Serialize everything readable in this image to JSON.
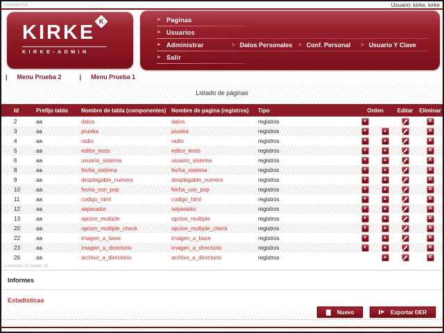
{
  "meta": {
    "version_label": "Versión C#",
    "user_label": "Usuario: kirke, kirke"
  },
  "logo": {
    "title": "KIRKE",
    "subtitle": "KIRKE-ADMIN",
    "badge_letter": "K"
  },
  "menu": {
    "items": [
      {
        "label": "Paginas"
      },
      {
        "label": "Usuarios"
      },
      {
        "label": "Administrar"
      },
      {
        "label": "Salir"
      }
    ],
    "submenu": [
      {
        "label": "Datos Personales"
      },
      {
        "label": "Conf. Personal"
      },
      {
        "label": "Usuario Y Clave"
      }
    ]
  },
  "secondary_menu": {
    "separator": "|",
    "items": [
      {
        "label": "Menu Prueba 2"
      },
      {
        "label": "Menu Prueba 1"
      }
    ]
  },
  "page": {
    "title": "Listado de páginas"
  },
  "table": {
    "columns": {
      "id": "Id",
      "prefijo": "Prefijo tabla",
      "tabla": "Nombre de tabla (componentes)",
      "pagina": "Nombre de pagina (registros)",
      "tipo": "Tipo",
      "orden": "Orden",
      "editar": "Editar",
      "eliminar": "Eliminar"
    },
    "rows": [
      {
        "id": "2",
        "prefijo": "aa",
        "tabla": "datos",
        "pagina": "datos",
        "tipo": "registros",
        "down": true,
        "up": false
      },
      {
        "id": "3",
        "prefijo": "aa",
        "tabla": "prueba",
        "pagina": "prueba",
        "tipo": "registros",
        "down": true,
        "up": true
      },
      {
        "id": "4",
        "prefijo": "aa",
        "tabla": "radio",
        "pagina": "radio",
        "tipo": "registros",
        "down": true,
        "up": true
      },
      {
        "id": "5",
        "prefijo": "aa",
        "tabla": "editor_texto",
        "pagina": "editor_texto",
        "tipo": "registros",
        "down": true,
        "up": true
      },
      {
        "id": "6",
        "prefijo": "aa",
        "tabla": "usuario_sistema",
        "pagina": "usuario_sistema",
        "tipo": "registros",
        "down": true,
        "up": true
      },
      {
        "id": "8",
        "prefijo": "aa",
        "tabla": "fecha_sistema",
        "pagina": "fecha_sistema",
        "tipo": "registros",
        "down": true,
        "up": true
      },
      {
        "id": "9",
        "prefijo": "aa",
        "tabla": "desplegable_numero",
        "pagina": "desplegable_numero",
        "tipo": "registros",
        "down": true,
        "up": true
      },
      {
        "id": "10",
        "prefijo": "aa",
        "tabla": "fecha_con_pop",
        "pagina": "fecha_con_pop",
        "tipo": "registros",
        "down": true,
        "up": true
      },
      {
        "id": "11",
        "prefijo": "aa",
        "tabla": "codigo_html",
        "pagina": "codigo_html",
        "tipo": "registros",
        "down": true,
        "up": true
      },
      {
        "id": "12",
        "prefijo": "aa",
        "tabla": "separador",
        "pagina": "separador",
        "tipo": "registros",
        "down": true,
        "up": true
      },
      {
        "id": "13",
        "prefijo": "aa",
        "tabla": "opcion_multiple",
        "pagina": "opcion_multiple",
        "tipo": "registros",
        "down": true,
        "up": true
      },
      {
        "id": "20",
        "prefijo": "aa",
        "tabla": "opcion_multiple_check",
        "pagina": "opcion_multiple_check",
        "tipo": "registros",
        "down": true,
        "up": true
      },
      {
        "id": "22",
        "prefijo": "aa",
        "tabla": "imagen_a_base",
        "pagina": "imagen_a_base",
        "tipo": "registros",
        "down": true,
        "up": true
      },
      {
        "id": "23",
        "prefijo": "aa",
        "tabla": "imagen_a_directorio",
        "pagina": "imagen_a_directorio",
        "tipo": "registros",
        "down": true,
        "up": true
      },
      {
        "id": "26",
        "prefijo": "aa",
        "tabla": "archivo_a_directorio",
        "pagina": "archivo_a_directorio",
        "tipo": "registros",
        "down": false,
        "up": true
      }
    ],
    "status_note": "Columnas: 8  Lineas: 15"
  },
  "sections": {
    "informes": "Informes",
    "estadisticas": "Estadisticas"
  },
  "actions": {
    "nuevo": "Nuevo",
    "exportar": "Exportar DER"
  },
  "icons": {
    "menu_arrow": "►",
    "submenu_arrow": ">",
    "order_down": "▼",
    "order_up": "▲",
    "delete_x": "×",
    "export_play": "▶"
  },
  "colors": {
    "maroon": "#8c1722",
    "maroon_dark": "#7a0f1a",
    "table_header": "#8c1b26",
    "link_red": "#c63434",
    "rule_red": "#7d1019"
  }
}
